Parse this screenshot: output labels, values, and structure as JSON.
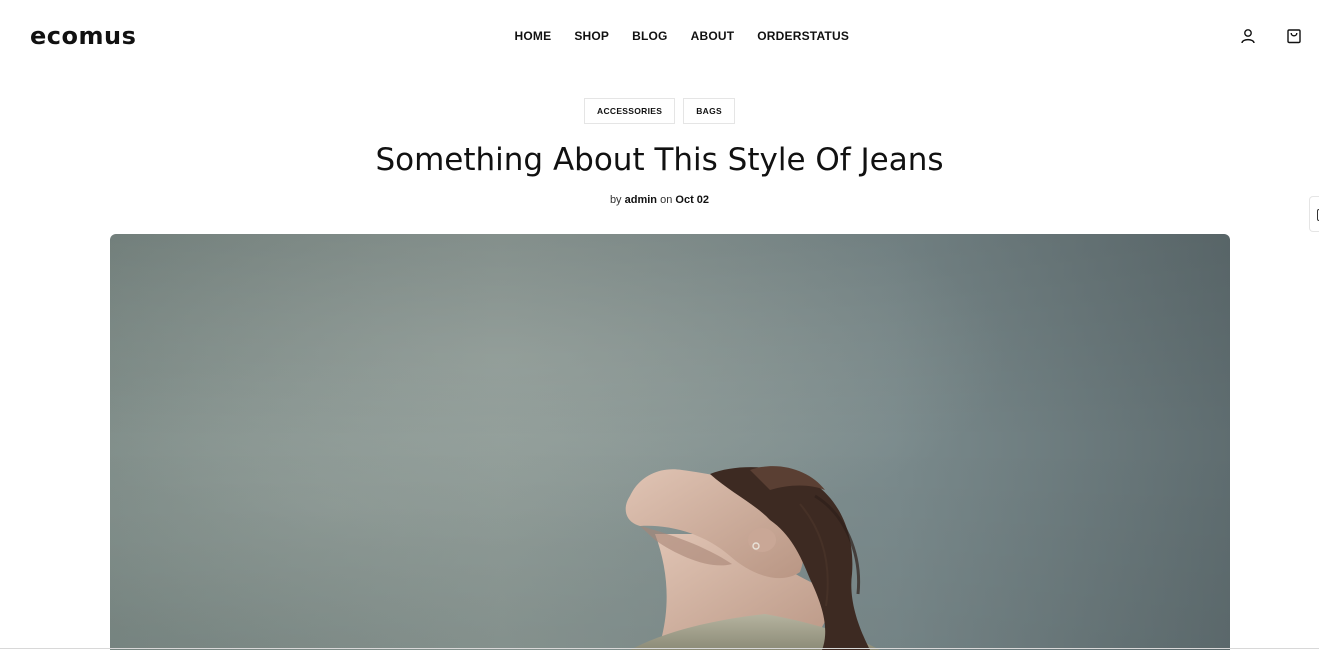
{
  "brand": {
    "logo_text": "ecomus"
  },
  "nav": {
    "items": [
      {
        "label": "HOME"
      },
      {
        "label": "SHOP"
      },
      {
        "label": "BLOG"
      },
      {
        "label": "ABOUT"
      },
      {
        "label": "ORDERSTATUS"
      }
    ]
  },
  "header_icons": [
    "user-icon",
    "cart-icon"
  ],
  "post": {
    "tags": [
      {
        "label": "ACCESSORIES"
      },
      {
        "label": "BAGS"
      }
    ],
    "title": "Something About This Style Of Jeans",
    "meta": {
      "by_prefix": "by",
      "author": "admin",
      "on_prefix": "on",
      "date": "Oct 02"
    },
    "hero_image": {
      "subject": "person with head tilted back against an overcast sky"
    }
  },
  "colors": {
    "text": "#111111",
    "sky": "#7f8f8c",
    "border": "#e5e5e5"
  }
}
